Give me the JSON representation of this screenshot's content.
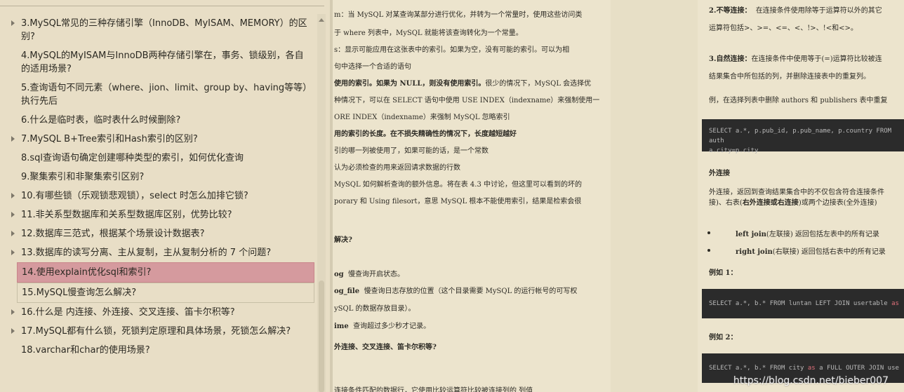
{
  "toc": {
    "items": [
      {
        "label": "3.MySQL常见的三种存储引擎（InnoDB、MyISAM、MEMORY）的区别?",
        "arrow": true
      },
      {
        "label": "4.MySQL的MyISAM与InnoDB两种存储引擎在，事务、锁级别，各自的适用场景?",
        "arrow": false
      },
      {
        "label": "5.查询语句不同元素（where、jion、limit、group by、having等等）执行先后",
        "arrow": false
      },
      {
        "label": "6.什么是临时表，临时表什么时候删除?",
        "arrow": false
      },
      {
        "label": "7.MySQL B+Tree索引和Hash索引的区别?",
        "arrow": true
      },
      {
        "label": "8.sql查询语句确定创建哪种类型的索引，如何优化查询",
        "arrow": false
      },
      {
        "label": "9.聚集索引和非聚集索引区别?",
        "arrow": false
      },
      {
        "label": "10.有哪些锁（乐观锁悲观锁），select 时怎么加排它锁?",
        "arrow": true
      },
      {
        "label": "11.非关系型数据库和关系型数据库区别，优势比较?",
        "arrow": true
      },
      {
        "label": "12.数据库三范式，根据某个场景设计数据表?",
        "arrow": true
      },
      {
        "label": "13.数据库的读写分离、主从复制，主从复制分析的 7 个问题?",
        "arrow": true
      },
      {
        "label": "14.使用explain优化sql和索引?",
        "arrow": false
      },
      {
        "label": "15.MySQL慢查询怎么解决?",
        "arrow": false
      },
      {
        "label": "16.什么是 内连接、外连接、交叉连接、笛卡尔积等?",
        "arrow": true
      },
      {
        "label": "17.MySQL都有什么锁，死锁判定原理和具体场景，死锁怎么解决?",
        "arrow": true
      },
      {
        "label": "18.varchar和char的使用场景?",
        "arrow": false
      }
    ]
  },
  "middle": {
    "lines": [
      "m：当 MySQL 对某查询某部分进行优化，并转为一个常量时，使用这些访问类",
      "于 where 列表中，MySQL 就能将该查询转化为一个常量。",
      "s：显示可能应用在这张表中的索引。如果为空，没有可能的索引。可以为相",
      "句中选择一个合适的语句",
      "使用的索引。如果为 NULL，则没有使用索引。",
      "很少的情况下，MySQL 会选择优",
      "种情况下，可以在 SELECT 语句中使用 USE INDEX（indexname）来强制使用一",
      "ORE INDEX（indexname）来强制 MySQL 忽略索引",
      "用的索引的长度。在不损失精确性的情况下，长度越短越好",
      "引的哪一列被使用了，如果可能的话，是一个常数",
      "认为必须检查的用来返回请求数据的行数",
      "MySQL 如何解析查询的额外信息。将在表 4.3 中讨论，但这里可以看到的坏的",
      "porary 和 Using filesort，意思 MySQL 根本不能使用索引，结果是检索会很",
      "解决?",
      "og",
      "慢查询开启状态。",
      "og_file",
      "慢查询日志存放的位置（这个目录需要 MySQL 的运行帐号的可写权",
      "ySQL 的数据存放目录）。",
      "ime",
      "查询超过多少秒才记录。",
      "外连接、交叉连接、笛卡尔积等?",
      "连接条件匹配的数据行，它使用比较运算符比较被连接列的 列值"
    ]
  },
  "right": {
    "l1_bold": "2.不等连接：",
    "l1": "在连接条件使用除等于运算符以外的其它",
    "l2": "运算符包括>、>=、<=、<、!>、!<和<>。",
    "l3_bold": "3.自然连接：",
    "l3": "在连接条件中使用等于(=)运算符比较被连",
    "l4": "结果集合中所包括的列，并删除连接表中的重复列。",
    "l5": "例，在选择列表中删除 authors 和 publishers 表中重复",
    "code1_a": "SELECT a.*, p.pub_id, p.pub_name, p.country FROM auth",
    "code1_b": "a.city=p.city",
    "h_outer": "外连接",
    "l6": "外连接，返回到查询结果集合中的不仅包含符合连接条件",
    "l7_a": "接)、右表(",
    "l7_b": "右外连接或右连接",
    "l7_c": ")或两个边接表(全外连接)",
    "b1_bold": "left join",
    "b1": "(左联接) 返回包括左表中的所有记录",
    "b2_bold": "right join",
    "b2": "(右联接) 返回包括右表中的所有记录",
    "ex1": "例如 1：",
    "code2_a": "SELECT a.*, b.* FROM luntan LEFT JOIN usertable ",
    "code2_kw": "as",
    "ex2": "例如 2：",
    "code3_a": "SELECT a.*, b.* FROM city ",
    "code3_kw": "as",
    "code3_b": " a FULL OUTER JOIN use"
  },
  "watermark": "https://blog.csdn.net/bieber007"
}
